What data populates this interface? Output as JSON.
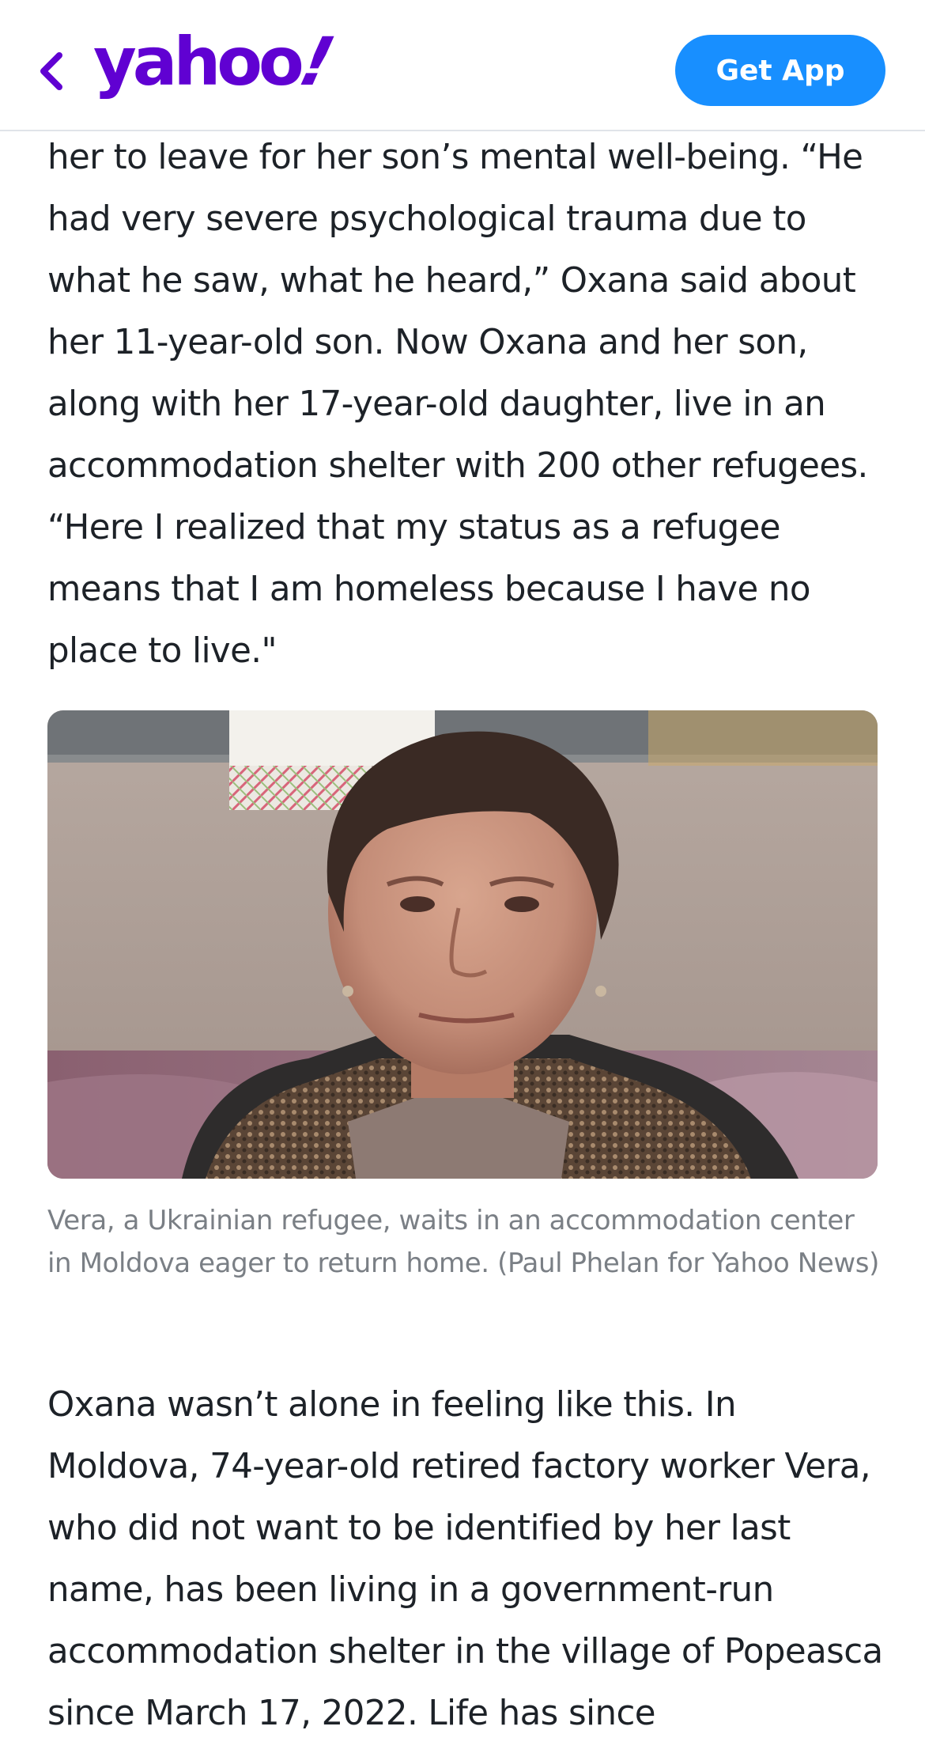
{
  "header": {
    "logo_text": "yahoo",
    "logo_mark": "!",
    "get_app_label": "Get App",
    "accent_color": "#6001d2",
    "button_color": "#188fff",
    "back_icon": "chevron-left-icon"
  },
  "article": {
    "paragraph_1": "her to leave for her son’s mental well-being. “He had very severe psychological trauma due to what he saw, what he heard,” Oxana said about her 11-year-old son. Now Oxana and her son, along with her 17-year-old daughter, live in an accommodation shelter with 200 other refugees. “Here I realized that my status as a refugee means that I am homeless because I have no place to live.\"",
    "image_description_icon": "photo-portrait",
    "caption": "Vera, a Ukrainian refugee, waits in an accommodation center in Moldova eager to return home. (Paul Phelan for Yahoo News)",
    "paragraph_2": "Oxana wasn’t alone in feeling like this. In Moldova, 74-year-old retired factory worker Vera, who did not want to be identified by her last name, has been living in a government-run accommodation shelter in the village of Popeasca since March 17, 2022. Life has since"
  }
}
